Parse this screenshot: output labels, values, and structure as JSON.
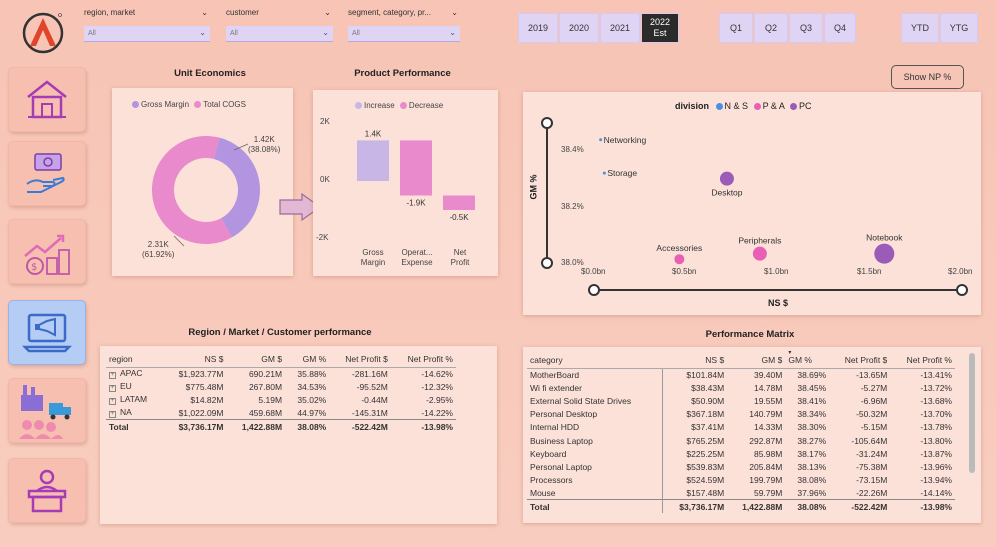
{
  "filters": [
    {
      "label": "region, market",
      "value": "All"
    },
    {
      "label": "customer",
      "value": "All"
    },
    {
      "label": "segment, category, pr...",
      "value": "All"
    }
  ],
  "years": [
    {
      "label": "2019",
      "selected": false
    },
    {
      "label": "2020",
      "selected": false
    },
    {
      "label": "2021",
      "selected": false
    },
    {
      "label": "2022",
      "sub": "Est",
      "selected": true
    }
  ],
  "quarters": [
    "Q1",
    "Q2",
    "Q3",
    "Q4"
  ],
  "periods": [
    "YTD",
    "YTG"
  ],
  "show_np_label": "Show NP %",
  "nav": [
    "home-icon",
    "hand-money-icon",
    "growth-chart-icon",
    "megaphone-laptop-icon",
    "supply-chain-icon",
    "cashier-icon"
  ],
  "unit_economics": {
    "title": "Unit Economics",
    "legend": [
      {
        "name": "Gross Margin",
        "color": "#b394e0"
      },
      {
        "name": "Total COGS",
        "color": "#e88acb"
      }
    ],
    "chart_data": {
      "type": "pie",
      "slices": [
        {
          "name": "Gross Margin",
          "value": 1.42,
          "label": "1.42K",
          "pct": "(38.08%)"
        },
        {
          "name": "Total COGS",
          "value": 2.31,
          "label": "2.31K",
          "pct": "(61.92%)"
        }
      ]
    }
  },
  "product_performance": {
    "title": "Product Performance",
    "legend": [
      {
        "name": "Increase",
        "color": "#c8b6e6"
      },
      {
        "name": "Decrease",
        "color": "#e88acb"
      }
    ],
    "y_ticks": [
      "2K",
      "0K",
      "-2K"
    ],
    "chart_data": {
      "type": "bar",
      "categories": [
        "Gross Margin",
        "Operat... Expense",
        "Net Profit"
      ],
      "cat_lines": [
        [
          "Gross",
          "Margin"
        ],
        [
          "Operat...",
          "Expense"
        ],
        [
          "Net",
          "Profit"
        ]
      ],
      "values": [
        1.4,
        -1.9,
        -0.5
      ],
      "labels": [
        "1.4K",
        "-1.9K",
        "-0.5K"
      ],
      "ylim": [
        -2,
        2
      ]
    }
  },
  "division_scatter": {
    "legend_title": "division",
    "legend": [
      {
        "name": "N & S",
        "color": "#4a90e2"
      },
      {
        "name": "P & A",
        "color": "#e85fb5"
      },
      {
        "name": "PC",
        "color": "#9b5bb8"
      }
    ],
    "y_axis_title": "GM %",
    "x_axis_title": "NS $",
    "y_ticks": [
      "38.4%",
      "38.2%",
      "38.0%"
    ],
    "x_ticks": [
      "$0.0bn",
      "$0.5bn",
      "$1.0bn",
      "$1.5bn",
      "$2.0bn"
    ],
    "chart_data": {
      "type": "scatter",
      "xlim": [
        0,
        2.0
      ],
      "ylim": [
        38.0,
        38.45
      ],
      "points": [
        {
          "name": "Networking",
          "x": 0.02,
          "y": 38.44,
          "color": "#4a90e2",
          "r": 1.5
        },
        {
          "name": "Storage",
          "x": 0.04,
          "y": 38.32,
          "color": "#4a90e2",
          "r": 1.5
        },
        {
          "name": "Desktop",
          "x": 0.71,
          "y": 38.3,
          "color": "#9b5bb8",
          "r": 7
        },
        {
          "name": "Accessories",
          "x": 0.45,
          "y": 38.01,
          "color": "#e85fb5",
          "r": 5
        },
        {
          "name": "Peripherals",
          "x": 0.89,
          "y": 38.03,
          "color": "#e85fb5",
          "r": 7
        },
        {
          "name": "Notebook",
          "x": 1.57,
          "y": 38.03,
          "color": "#9b5bb8",
          "r": 10
        }
      ]
    }
  },
  "region_table": {
    "title": "Region / Market / Customer performance",
    "headers": [
      "region",
      "NS $",
      "GM $",
      "GM %",
      "Net Profit $",
      "Net Profit %"
    ],
    "rows": [
      [
        "APAC",
        "$1,923.77M",
        "690.21M",
        "35.88%",
        "-281.16M",
        "-14.62%"
      ],
      [
        "EU",
        "$775.48M",
        "267.80M",
        "34.53%",
        "-95.52M",
        "-12.32%"
      ],
      [
        "LATAM",
        "$14.82M",
        "5.19M",
        "35.02%",
        "-0.44M",
        "-2.95%"
      ],
      [
        "NA",
        "$1,022.09M",
        "459.68M",
        "44.97%",
        "-145.31M",
        "-14.22%"
      ]
    ],
    "total": [
      "Total",
      "$3,736.17M",
      "1,422.88M",
      "38.08%",
      "-522.42M",
      "-13.98%"
    ]
  },
  "matrix_table": {
    "title": "Performance Matrix",
    "headers": [
      "category",
      "NS $",
      "GM $",
      "GM %",
      "Net Profit $",
      "Net Profit %"
    ],
    "rows": [
      [
        "MotherBoard",
        "$101.84M",
        "39.40M",
        "38.69%",
        "-13.65M",
        "-13.41%"
      ],
      [
        "Wi fi extender",
        "$38.43M",
        "14.78M",
        "38.45%",
        "-5.27M",
        "-13.72%"
      ],
      [
        "External Solid State Drives",
        "$50.90M",
        "19.55M",
        "38.41%",
        "-6.96M",
        "-13.68%"
      ],
      [
        "Personal Desktop",
        "$367.18M",
        "140.79M",
        "38.34%",
        "-50.32M",
        "-13.70%"
      ],
      [
        "Internal HDD",
        "$37.41M",
        "14.33M",
        "38.30%",
        "-5.15M",
        "-13.78%"
      ],
      [
        "Business Laptop",
        "$765.25M",
        "292.87M",
        "38.27%",
        "-105.64M",
        "-13.80%"
      ],
      [
        "Keyboard",
        "$225.25M",
        "85.98M",
        "38.17%",
        "-31.24M",
        "-13.87%"
      ],
      [
        "Personal Laptop",
        "$539.83M",
        "205.84M",
        "38.13%",
        "-75.38M",
        "-13.96%"
      ],
      [
        "Processors",
        "$524.59M",
        "199.79M",
        "38.08%",
        "-73.15M",
        "-13.94%"
      ],
      [
        "Mouse",
        "$157.48M",
        "59.79M",
        "37.96%",
        "-22.26M",
        "-14.14%"
      ]
    ],
    "total": [
      "Total",
      "$3,736.17M",
      "1,422.88M",
      "38.08%",
      "-522.42M",
      "-13.98%"
    ]
  }
}
